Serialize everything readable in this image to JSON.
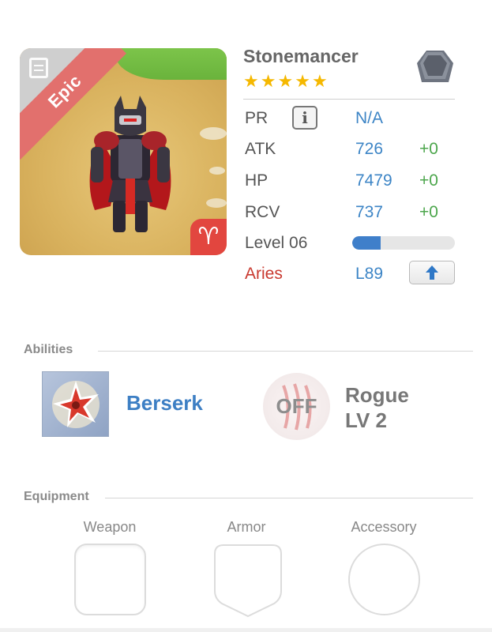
{
  "unit": {
    "name": "Stonemancer",
    "rarity_label": "Epic",
    "stars": 5,
    "element_icon": "stone-hexagon-icon",
    "zodiac_glyph": "♈"
  },
  "stats": {
    "pr_label": "PR",
    "pr_value": "N/A",
    "atk_label": "ATK",
    "atk_value": "726",
    "atk_bonus": "+0",
    "hp_label": "HP",
    "hp_value": "7479",
    "hp_bonus": "+0",
    "rcv_label": "RCV",
    "rcv_value": "737",
    "rcv_bonus": "+0",
    "level_label": "Level 06",
    "level_progress": 0.28,
    "sign_label": "Aries",
    "sign_level": "L89"
  },
  "abilities": {
    "title": "Abilities",
    "active_name": "Berserk",
    "passive_state": "OFF",
    "passive_name_line1": "Rogue",
    "passive_name_line2": "LV 2"
  },
  "equipment": {
    "title": "Equipment",
    "weapon_label": "Weapon",
    "armor_label": "Armor",
    "accessory_label": "Accessory"
  },
  "colors": {
    "accent_blue": "#3d85c6",
    "bonus_green": "#4ca64c",
    "sign_red": "#c9392f",
    "epic_ribbon": "#e2706d",
    "star_gold": "#f5b800"
  }
}
